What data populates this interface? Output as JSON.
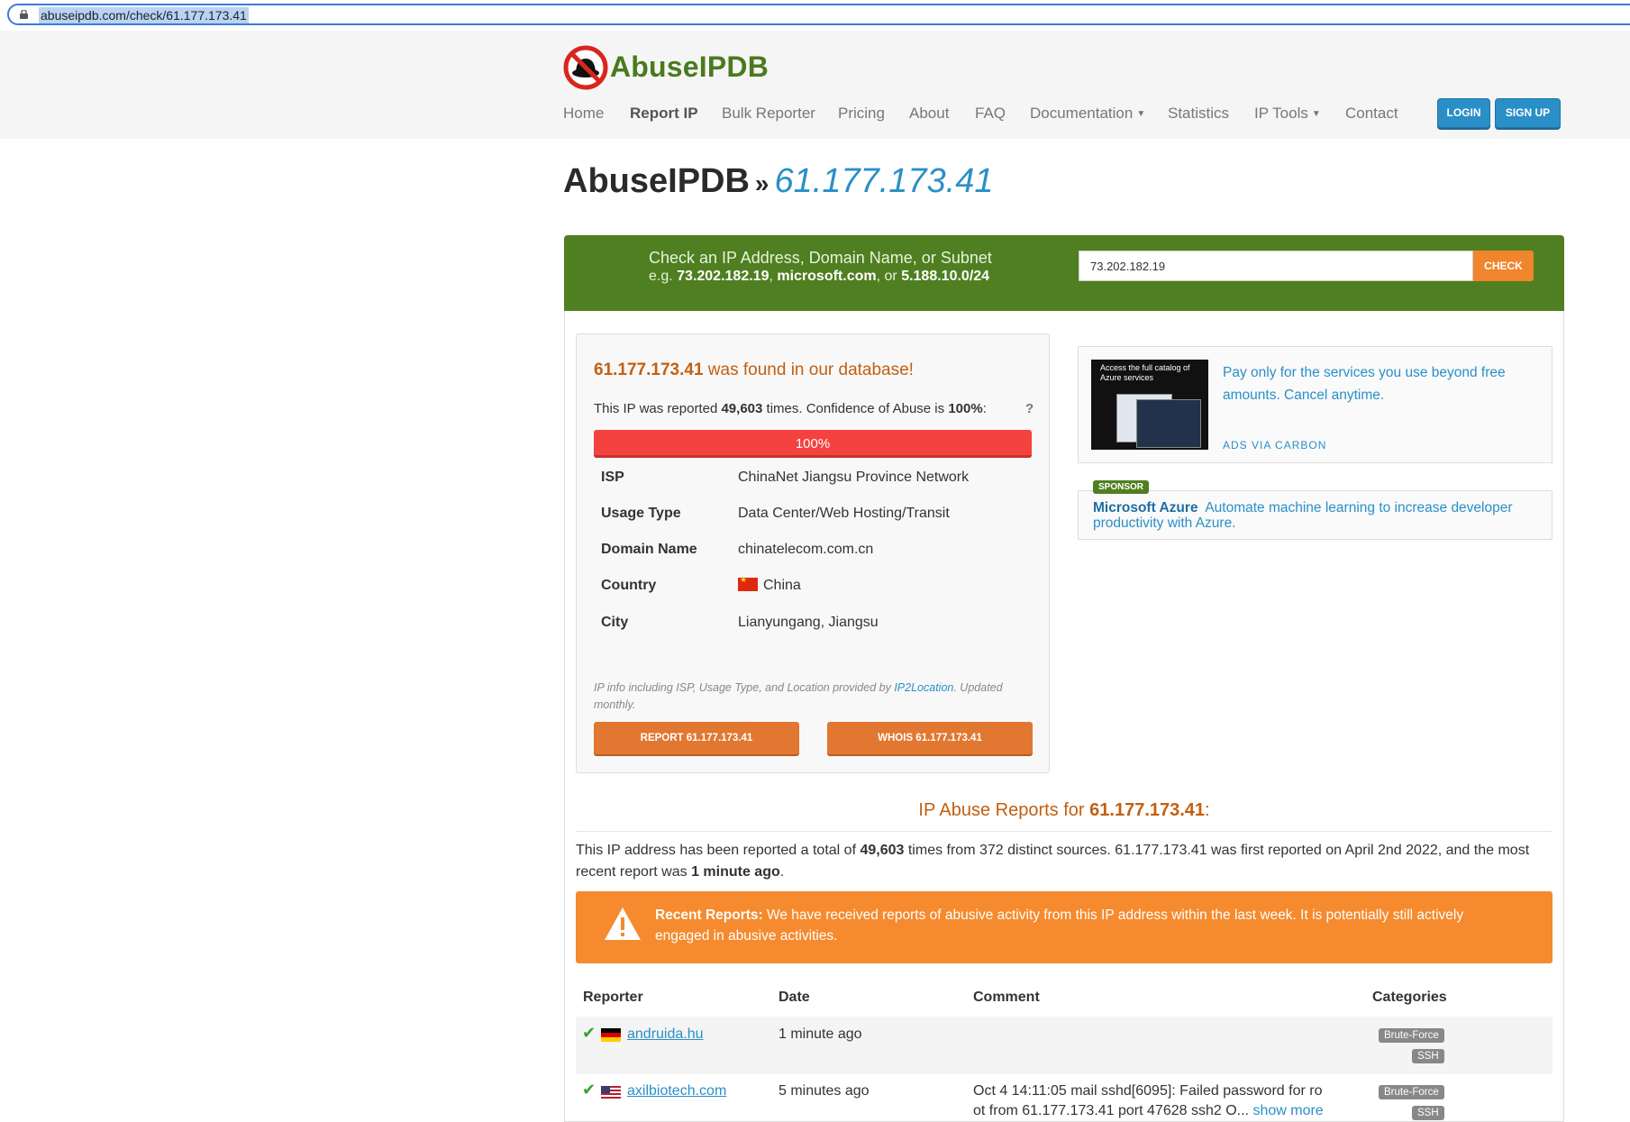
{
  "browser": {
    "url": "abuseipdb.com/check/61.177.173.41"
  },
  "header": {
    "logo_text": "AbuseIPDB",
    "nav": [
      {
        "label": "Home"
      },
      {
        "label": "Report IP"
      },
      {
        "label": "Bulk Reporter"
      },
      {
        "label": "Pricing"
      },
      {
        "label": "About"
      },
      {
        "label": "FAQ"
      },
      {
        "label": "Documentation"
      },
      {
        "label": "Statistics"
      },
      {
        "label": "IP Tools"
      },
      {
        "label": "Contact"
      }
    ],
    "login": "LOGIN",
    "signup": "SIGN UP"
  },
  "title": {
    "site": "AbuseIPDB",
    "sep": "»",
    "ip": "61.177.173.41"
  },
  "search": {
    "line1": "Check an IP Address, Domain Name, or Subnet",
    "eg_prefix": "e.g.",
    "eg1": "73.202.182.19",
    "eg2": "microsoft.com",
    "eg_or": "or",
    "eg3": "5.188.10.0/24",
    "value": "73.202.182.19",
    "button": "CHECK"
  },
  "result": {
    "ip": "61.177.173.41",
    "found_suffix": "was found in our database!",
    "reported_prefix": "This IP was reported",
    "reported_count": "49,603",
    "reported_mid": "times. Confidence of Abuse is",
    "confidence": "100%",
    "help": "?",
    "confidence_value": 1.0,
    "bar_label": "100%",
    "rows": [
      {
        "key": "ISP",
        "value": "ChinaNet Jiangsu Province Network"
      },
      {
        "key": "Usage Type",
        "value": "Data Center/Web Hosting/Transit"
      },
      {
        "key": "Domain Name",
        "value": "chinatelecom.com.cn"
      },
      {
        "key": "Country",
        "value": "China"
      },
      {
        "key": "City",
        "value": "Lianyungang, Jiangsu"
      }
    ],
    "provided_text": "IP info including ISP, Usage Type, and Location provided by",
    "provided_link": "IP2Location",
    "provided_suffix": ". Updated monthly.",
    "report_btn": "REPORT 61.177.173.41",
    "whois_btn": "WHOIS 61.177.173.41"
  },
  "ad": {
    "image_text": "Access the full catalog of Azure services",
    "copy": "Pay only for the services you use beyond free amounts. Cancel anytime.",
    "via": "ADS VIA CARBON"
  },
  "sponsor": {
    "tag": "SPONSOR",
    "brand": "Microsoft Azure",
    "text": "Automate machine learning to increase developer productivity with Azure."
  },
  "reports": {
    "heading_prefix": "IP Abuse Reports for",
    "heading_ip": "61.177.173.41",
    "heading_suffix": ":",
    "summary_a": "This IP address has been reported a total of",
    "summary_count": "49,603",
    "summary_b": "times from 372 distinct sources. 61.177.173.41 was first reported on April 2nd 2022, and the most recent report was",
    "summary_recent": "1 minute ago",
    "summary_end": ".",
    "alert_bold": "Recent Reports:",
    "alert_text": "We have received reports of abusive activity from this IP address within the last week. It is potentially still actively engaged in abusive activities.",
    "columns": [
      "Reporter",
      "Date",
      "Comment",
      "Categories"
    ],
    "rows": [
      {
        "reporter": "andruida.hu",
        "date": "1 minute ago",
        "comment": "",
        "categories": [
          "Brute-Force",
          "SSH"
        ]
      },
      {
        "reporter": "axilbiotech.com",
        "date": "5 minutes ago",
        "comment": "Oct 4 14:11:05 mail sshd[6095]: Failed password for ro",
        "comment2": "ot from 61.177.173.41 port 47628 ssh2 O...",
        "show_more": "show more",
        "categories": [
          "Brute-Force",
          "SSH"
        ]
      }
    ]
  },
  "colors": {
    "brand_green": "#4f7f20",
    "accent_blue": "#2a8fc7",
    "orange": "#f0852d",
    "danger_red": "#f4433f"
  }
}
